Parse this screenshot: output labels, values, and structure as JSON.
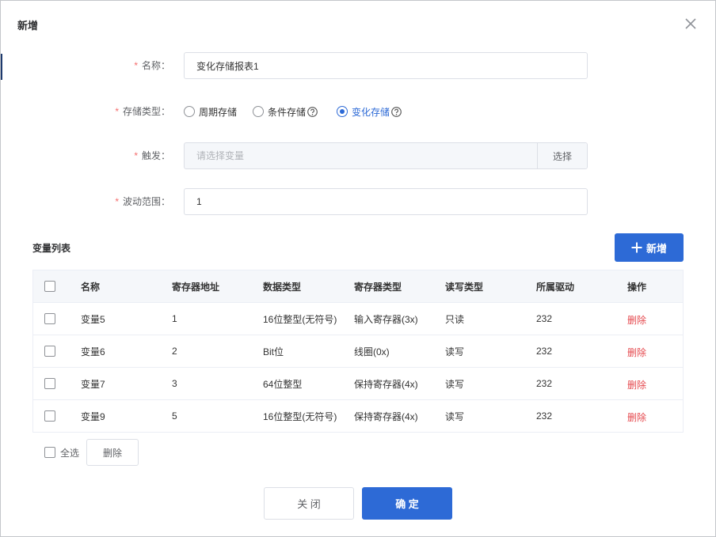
{
  "colors": {
    "primary": "#2d6ad6",
    "danger": "#e5484d",
    "required": "#f56c6c"
  },
  "dialog": {
    "title": "新增",
    "close_icon": "close-icon"
  },
  "form": {
    "required_mark": "*",
    "name": {
      "label": "名称：",
      "value": "变化存储报表1"
    },
    "storage_type": {
      "label": "存储类型：",
      "help_icon": "question-circle-icon",
      "options": [
        {
          "label": "周期存储",
          "checked": false,
          "has_help": false
        },
        {
          "label": "条件存储",
          "checked": false,
          "has_help": true
        },
        {
          "label": "变化存储",
          "checked": true,
          "has_help": true
        }
      ]
    },
    "trigger": {
      "label": "触发：",
      "placeholder": "请选择变量",
      "button": "选择"
    },
    "fluctuation_range": {
      "label": "波动范围：",
      "value": "1"
    }
  },
  "variables": {
    "title": "变量列表",
    "add_button": {
      "icon": "plus-icon",
      "label": "新增"
    },
    "header_checked": false,
    "columns": [
      "名称",
      "寄存器地址",
      "数据类型",
      "寄存器类型",
      "读写类型",
      "所属驱动",
      "操作"
    ],
    "rows": [
      {
        "checked": false,
        "name": "变量5",
        "address": "1",
        "data_type": "16位整型(无符号)",
        "register_type": "输入寄存器(3x)",
        "access": "只读",
        "driver": "232",
        "action": "删除"
      },
      {
        "checked": false,
        "name": "变量6",
        "address": "2",
        "data_type": "Bit位",
        "register_type": "线圈(0x)",
        "access": "读写",
        "driver": "232",
        "action": "删除"
      },
      {
        "checked": false,
        "name": "变量7",
        "address": "3",
        "data_type": "64位整型",
        "register_type": "保持寄存器(4x)",
        "access": "读写",
        "driver": "232",
        "action": "删除"
      },
      {
        "checked": false,
        "name": "变量9",
        "address": "5",
        "data_type": "16位整型(无符号)",
        "register_type": "保持寄存器(4x)",
        "access": "读写",
        "driver": "232",
        "action": "删除"
      }
    ]
  },
  "footer": {
    "select_all": {
      "label": "全选",
      "checked": false
    },
    "batch_delete": "删除",
    "cancel": "关 闭",
    "confirm": "确 定"
  }
}
